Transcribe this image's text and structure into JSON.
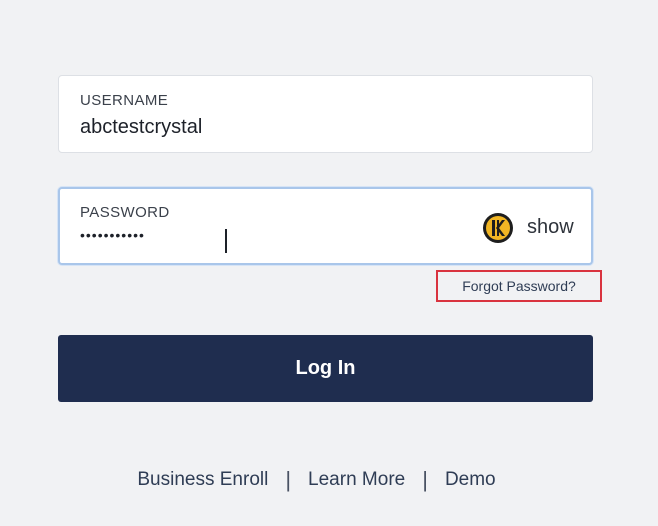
{
  "username": {
    "label": "USERNAME",
    "value": "abctestcrystal"
  },
  "password": {
    "label": "PASSWORD",
    "value": "•••••••••••",
    "show_label": "show",
    "manager_icon": "keeper-icon"
  },
  "forgot_password": {
    "label": "Forgot Password?",
    "highlight_color": "#d9333f"
  },
  "login_button": {
    "label": "Log In",
    "color": "#1f2d4f"
  },
  "footer": {
    "links": [
      {
        "label": "Business Enroll"
      },
      {
        "label": "Learn More"
      },
      {
        "label": "Demo"
      }
    ],
    "separator": "|"
  }
}
